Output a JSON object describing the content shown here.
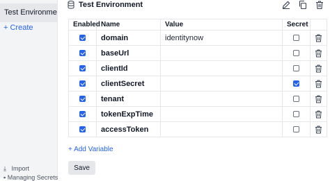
{
  "sidebar": {
    "environment": "Test Environment",
    "create_label": "+ Create",
    "import_label": "Import",
    "managing_label": "Managing Secrets"
  },
  "header": {
    "title": "Test Environment"
  },
  "table": {
    "columns": [
      "Enabled",
      "Name",
      "Value",
      "Secret"
    ],
    "rows": [
      {
        "enabled": true,
        "name": "domain",
        "value": "identitynow",
        "secret": false
      },
      {
        "enabled": true,
        "name": "baseUrl",
        "value": "",
        "secret": false
      },
      {
        "enabled": true,
        "name": "clientId",
        "value": "",
        "secret": false
      },
      {
        "enabled": true,
        "name": "clientSecret",
        "value": "",
        "secret": true
      },
      {
        "enabled": true,
        "name": "tenant",
        "value": "",
        "secret": false
      },
      {
        "enabled": true,
        "name": "tokenExpTime",
        "value": "",
        "secret": false
      },
      {
        "enabled": true,
        "name": "accessToken",
        "value": "",
        "secret": false
      }
    ]
  },
  "add_variable_label": "+ Add Variable",
  "save_label": "Save",
  "colors": {
    "accent": "#2563eb",
    "sidebar_bg": "#f3f4f6"
  },
  "icons": {
    "header": "database-icon",
    "actions": [
      "edit-icon",
      "copy-icon",
      "delete-icon"
    ],
    "row_action": "trash-icon",
    "import": "download-icon"
  }
}
